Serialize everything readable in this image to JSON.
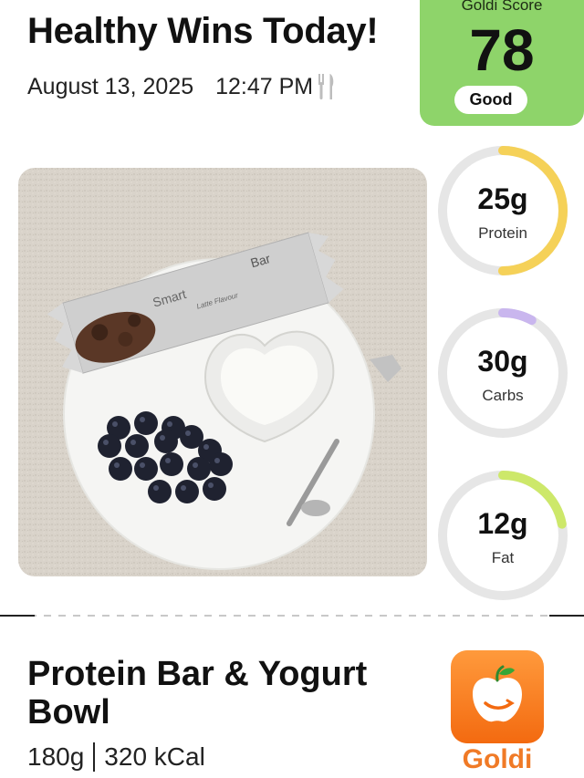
{
  "header": {
    "title": "Healthy Wins Today!",
    "date": "August 13, 2025",
    "time": "12:47 PM"
  },
  "score": {
    "label": "Goldi Score",
    "value": "78",
    "rating": "Good",
    "color": "#8ed46a"
  },
  "macros": [
    {
      "value": "25g",
      "label": "Protein",
      "fraction": 0.5,
      "color": "#f5d158"
    },
    {
      "value": "30g",
      "label": "Carbs",
      "fraction": 0.08,
      "color": "#c9b6ee"
    },
    {
      "value": "12g",
      "label": "Fat",
      "fraction": 0.22,
      "color": "#cde86a"
    }
  ],
  "meal": {
    "name": "Protein Bar & Yogurt Bowl",
    "weight": "180g",
    "calories": "320 kCal"
  },
  "app": {
    "name": "Goldi",
    "color": "#f07a26"
  },
  "photo": {
    "icon": "meal-photo",
    "bar_text": {
      "brand_left": "Smart",
      "brand_right": "Bar",
      "flavour": "Latte Flavour"
    }
  }
}
